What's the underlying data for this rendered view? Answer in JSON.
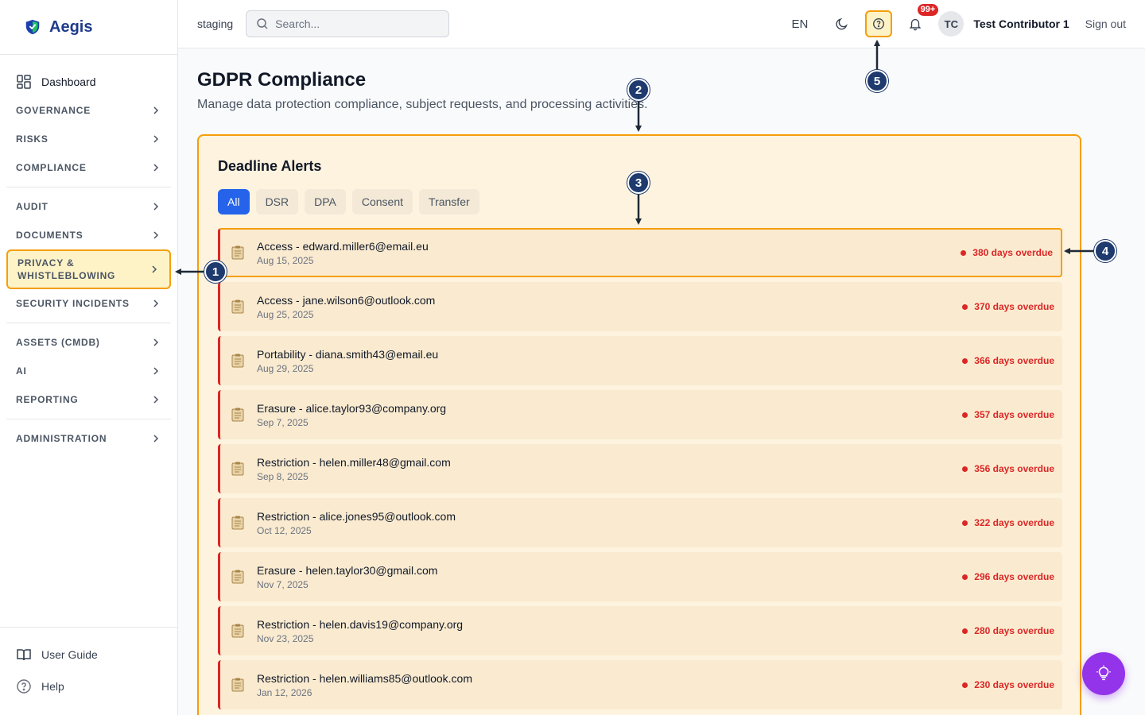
{
  "app": {
    "name": "Aegis"
  },
  "sidebar": {
    "dashboard_label": "Dashboard",
    "groups": [
      [
        "GOVERNANCE",
        "RISKS",
        "COMPLIANCE"
      ],
      [
        "AUDIT",
        "DOCUMENTS",
        "PRIVACY & WHISTLEBLOWING",
        "SECURITY INCIDENTS"
      ],
      [
        "ASSETS (CMDB)",
        "AI",
        "REPORTING"
      ],
      [
        "ADMINISTRATION"
      ]
    ],
    "user_guide_label": "User Guide",
    "help_label": "Help"
  },
  "header": {
    "environment": "staging",
    "search_placeholder": "Search...",
    "language": "EN",
    "notifications_badge": "99+",
    "user_initials": "TC",
    "user_name": "Test Contributor 1",
    "sign_out_label": "Sign out"
  },
  "page": {
    "title": "GDPR Compliance",
    "subtitle": "Manage data protection compliance, subject requests, and processing activities."
  },
  "deadline_alerts": {
    "title": "Deadline Alerts",
    "tabs": [
      "All",
      "DSR",
      "DPA",
      "Consent",
      "Transfer"
    ],
    "active_tab": "All",
    "items": [
      {
        "name": "Access - edward.miller6@email.eu",
        "date": "Aug 15, 2025",
        "status": "380 days overdue"
      },
      {
        "name": "Access - jane.wilson6@outlook.com",
        "date": "Aug 25, 2025",
        "status": "370 days overdue"
      },
      {
        "name": "Portability - diana.smith43@email.eu",
        "date": "Aug 29, 2025",
        "status": "366 days overdue"
      },
      {
        "name": "Erasure - alice.taylor93@company.org",
        "date": "Sep 7, 2025",
        "status": "357 days overdue"
      },
      {
        "name": "Restriction - helen.miller48@gmail.com",
        "date": "Sep 8, 2025",
        "status": "356 days overdue"
      },
      {
        "name": "Restriction - alice.jones95@outlook.com",
        "date": "Oct 12, 2025",
        "status": "322 days overdue"
      },
      {
        "name": "Erasure - helen.taylor30@gmail.com",
        "date": "Nov 7, 2025",
        "status": "296 days overdue"
      },
      {
        "name": "Restriction - helen.davis19@company.org",
        "date": "Nov 23, 2025",
        "status": "280 days overdue"
      },
      {
        "name": "Restriction - helen.williams85@outlook.com",
        "date": "Jan 12, 2026",
        "status": "230 days overdue"
      }
    ]
  },
  "callouts": [
    "1",
    "2",
    "3",
    "4",
    "5"
  ],
  "colors": {
    "accent": "#2563eb",
    "highlight": "#f59e0b",
    "overdue": "#dc2626",
    "callout": "#1e3a6e",
    "fab": "#9333ea"
  }
}
